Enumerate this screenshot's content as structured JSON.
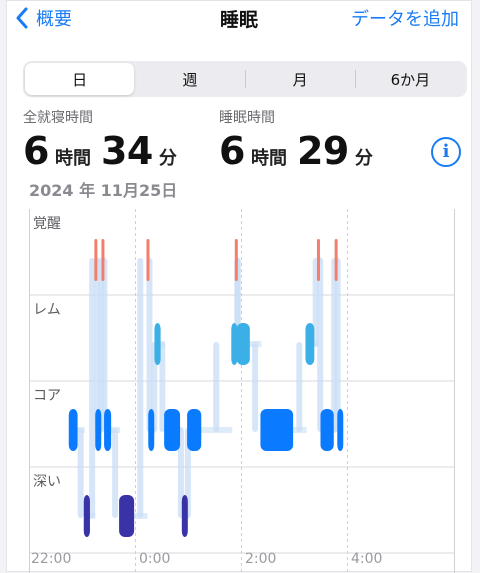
{
  "nav": {
    "back_label": "概要",
    "title": "睡眠",
    "add_label": "データを追加"
  },
  "segments": [
    "日",
    "週",
    "月",
    "6か月"
  ],
  "selected_segment": "日",
  "stats": {
    "total_in_bed": {
      "label": "全就寝時間",
      "hours": "6",
      "hours_unit": "時間",
      "minutes": "34",
      "minutes_unit": "分"
    },
    "asleep": {
      "label": "睡眠時間",
      "hours": "6",
      "hours_unit": "時間",
      "minutes": "29",
      "minutes_unit": "分"
    }
  },
  "date": "2024 年 11月25日",
  "chart_data": {
    "type": "hypnogram",
    "stages": [
      "覚醒",
      "レム",
      "コア",
      "深い"
    ],
    "x_ticks": [
      "22:00",
      "0:00",
      "2:00",
      "4:00"
    ],
    "colors": {
      "awake": "#f47e6b",
      "rem": "#3bb0e6",
      "core": "#0a7aff",
      "deep": "#3a32a7",
      "connector": "#c8def5"
    },
    "segments": [
      {
        "stage": "コア",
        "start": "22:45",
        "end": "22:55"
      },
      {
        "stage": "深い",
        "start": "23:02",
        "end": "23:09"
      },
      {
        "stage": "覚醒",
        "start": "23:14",
        "end": "23:15"
      },
      {
        "stage": "コア",
        "start": "23:15",
        "end": "23:20"
      },
      {
        "stage": "覚醒",
        "start": "23:22",
        "end": "23:23"
      },
      {
        "stage": "コア",
        "start": "23:25",
        "end": "23:33"
      },
      {
        "stage": "深い",
        "start": "23:42",
        "end": "23:59"
      },
      {
        "stage": "覚醒",
        "start": "0:13",
        "end": "0:14"
      },
      {
        "stage": "コア",
        "start": "0:15",
        "end": "0:20"
      },
      {
        "stage": "レム",
        "start": "0:22",
        "end": "0:29"
      },
      {
        "stage": "コア",
        "start": "0:33",
        "end": "0:51"
      },
      {
        "stage": "深い",
        "start": "0:53",
        "end": "0:57"
      },
      {
        "stage": "コア",
        "start": "0:59",
        "end": "1:15"
      },
      {
        "stage": "レム",
        "start": "1:49",
        "end": "1:54"
      },
      {
        "stage": "覚醒",
        "start": "1:53",
        "end": "1:54"
      },
      {
        "stage": "レム",
        "start": "1:55",
        "end": "2:10"
      },
      {
        "stage": "コア",
        "start": "2:22",
        "end": "2:59"
      },
      {
        "stage": "レム",
        "start": "3:13",
        "end": "3:23"
      },
      {
        "stage": "覚醒",
        "start": "3:26",
        "end": "3:27"
      },
      {
        "stage": "コア",
        "start": "3:30",
        "end": "3:45"
      },
      {
        "stage": "覚醒",
        "start": "3:46",
        "end": "3:48"
      },
      {
        "stage": "コア",
        "start": "3:49",
        "end": "3:50"
      }
    ]
  }
}
